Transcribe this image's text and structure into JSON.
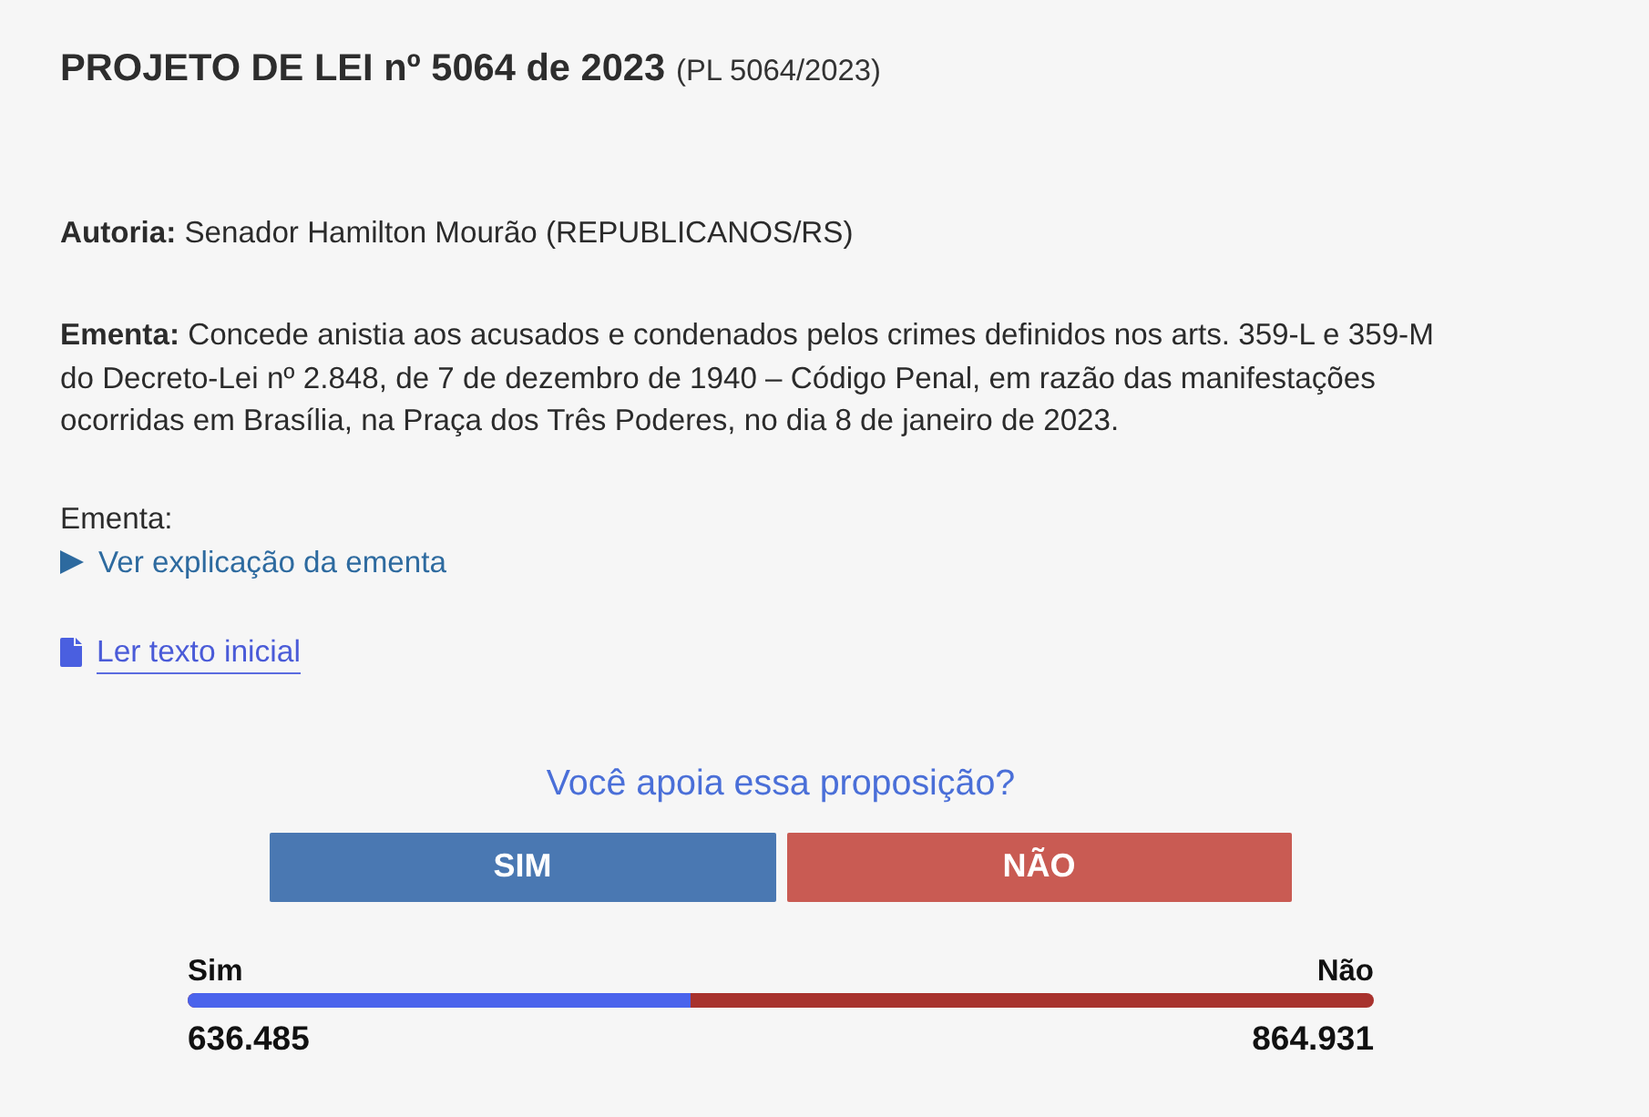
{
  "title": {
    "main": "PROJETO DE LEI nº 5064 de 2023",
    "code": "(PL 5064/2023)"
  },
  "authorship": "**Autoria:** Senador Hamilton Mourão (REPUBLICANOS/RS)",
  "summary": "**Ementa:** Concede anistia aos acusados e condenados pelos crimes definidos nos arts. 359-L e 359-M do Decreto-Lei nº 2.848, de 7 de dezembro de 1940 – Código Penal, em razão das manifestações ocorridas em Brasília, na Praça dos Três Poderes, no dia 8 de janeiro de 2023.",
  "explanation": {
    "label": "Ementa:",
    "toggle": "Ver explicação da ementa",
    "expanded": false
  },
  "initial_text_link": "Ler texto inicial",
  "poll": {
    "question": "Você apoia essa proposição?",
    "buttons": [
      {
        "label": "SIM",
        "kind": "yes"
      },
      {
        "label": "NÃO",
        "kind": "no"
      }
    ],
    "results": {
      "yes_label": "Sim",
      "no_label": "Não",
      "yes_count": "636.485",
      "no_count": "864.931",
      "level": 0.424
    }
  }
}
